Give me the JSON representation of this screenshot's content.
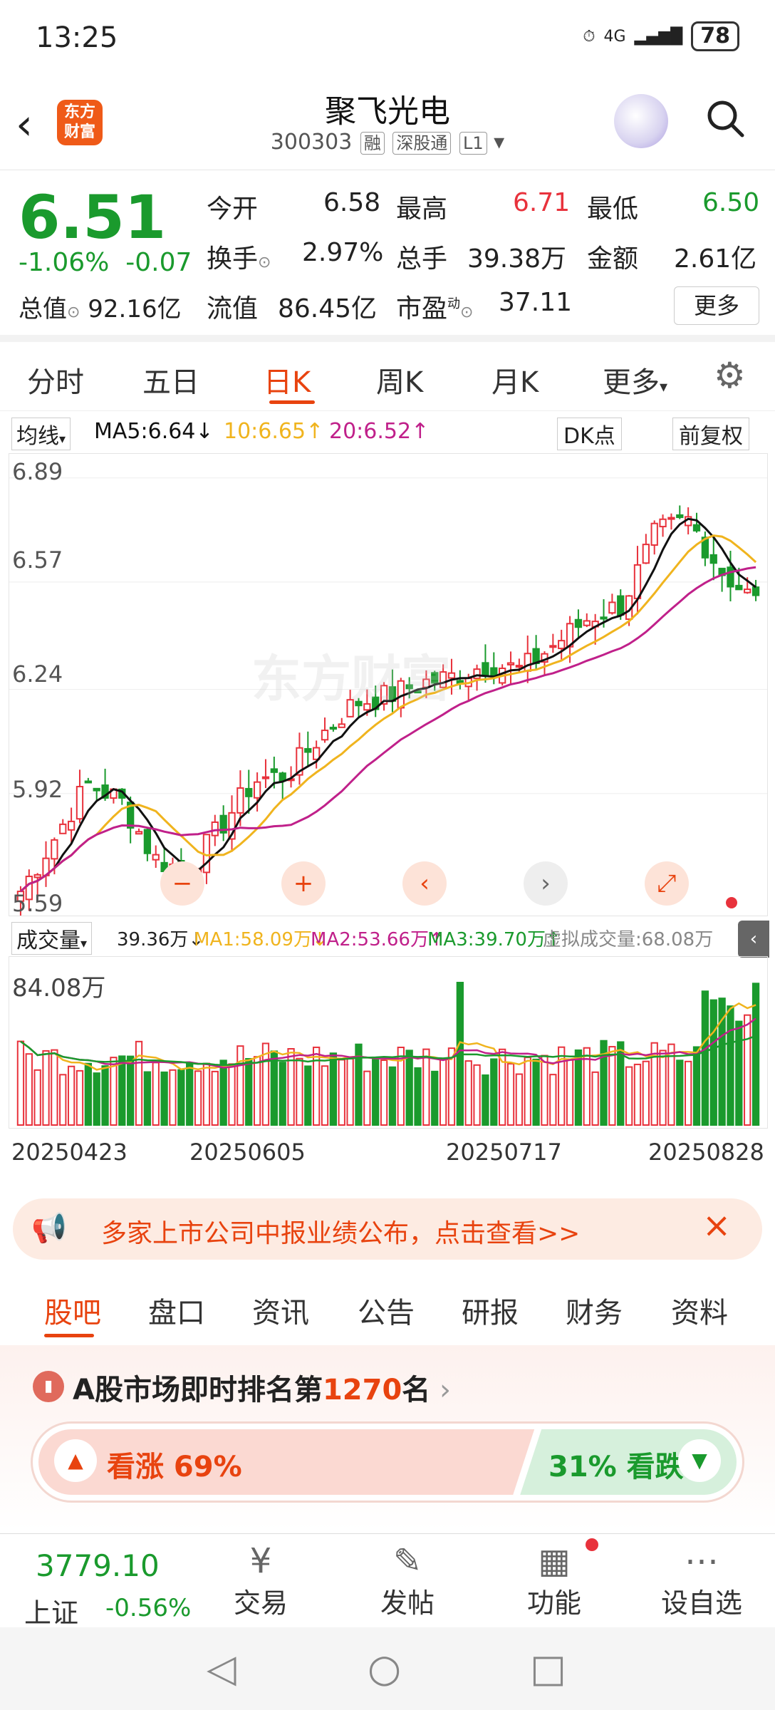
{
  "status": {
    "time": "13:25",
    "network": "4G",
    "battery": "78"
  },
  "header": {
    "back_icon": "chevron-left-icon",
    "logo_text": "东方财富",
    "title": "聚飞光电",
    "code": "300303",
    "tags": [
      "融",
      "深股通",
      "L1"
    ]
  },
  "quote": {
    "price": "6.51",
    "change_pct": "-1.06%",
    "change": "-0.07",
    "open_label": "今开",
    "open": "6.58",
    "high_label": "最高",
    "high": "6.71",
    "low_label": "最低",
    "low": "6.50",
    "turnover_label": "换手",
    "turnover": "2.97%",
    "volume_label": "总手",
    "volume": "39.38万",
    "amount_label": "金额",
    "amount": "2.61亿",
    "mcap_label": "总值",
    "mcap": "92.16亿",
    "float_label": "流值",
    "float": "86.45亿",
    "pe_label": "市盈",
    "pe_sup": "动",
    "pe": "37.11",
    "more": "更多"
  },
  "periods": [
    "分时",
    "五日",
    "日K",
    "周K",
    "月K",
    "更多"
  ],
  "ma": {
    "selector": "均线",
    "ma5": "MA5:6.64",
    "ma10": "10:6.65",
    "ma20": "20:6.52",
    "dk": "DK点",
    "fq": "前复权"
  },
  "chart": {
    "yticks": [
      "6.89",
      "6.57",
      "6.24",
      "5.92",
      "5.59"
    ],
    "watermark": "东方财富"
  },
  "volhead": {
    "selector": "成交量",
    "v": "39.36万",
    "ma1": "MA1:58.09万",
    "ma2": "MA2:53.66万",
    "ma3": "MA3:39.70万",
    "virtual": "虚拟成交量:68.08万"
  },
  "vol": {
    "max": "84.08万"
  },
  "dates": [
    "20250423",
    "20250605",
    "20250717",
    "20250828"
  ],
  "banner": {
    "text": "多家上市公司中报业绩公布，点击查看>>"
  },
  "tabs2": [
    "股吧",
    "盘口",
    "资讯",
    "公告",
    "研报",
    "财务",
    "资料"
  ],
  "rank": {
    "prefix": "A股市场即时排名第",
    "num": "1270",
    "suffix": "名",
    "up": "看涨 69%",
    "down": "31% 看跌",
    "up_pct": 69
  },
  "bottom": {
    "index_value": "3779.10",
    "index_name": "上证",
    "index_chg": "-0.56%",
    "items": [
      "交易",
      "发帖",
      "功能",
      "设自选"
    ]
  },
  "colors": {
    "up": "#e8323c",
    "down": "#1a9a2d",
    "accent": "#e8430f",
    "ma5": "#111111",
    "ma10": "#f0b41e",
    "ma20": "#c0208a"
  }
}
